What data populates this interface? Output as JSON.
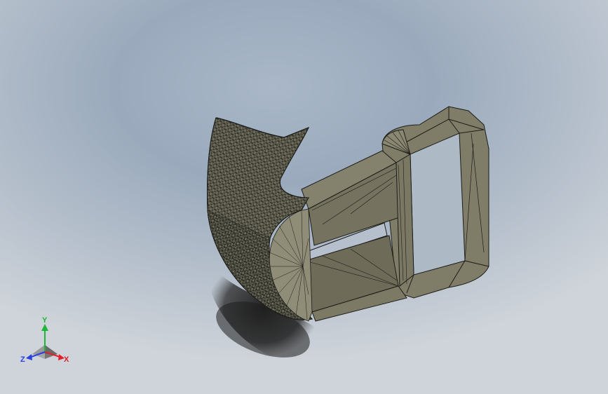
{
  "viewport": {
    "background_top": "#9aaabc",
    "background_bottom": "#cfd4da"
  },
  "model": {
    "display_mode": "shaded-with-edges",
    "face_color": "#7d7b66",
    "edge_color": "#1c1c18"
  },
  "triad": {
    "x_label": "X",
    "y_label": "Y",
    "z_label": "Z",
    "x_color": "#e0202a",
    "y_color": "#1fb53a",
    "z_color": "#2840e0"
  }
}
